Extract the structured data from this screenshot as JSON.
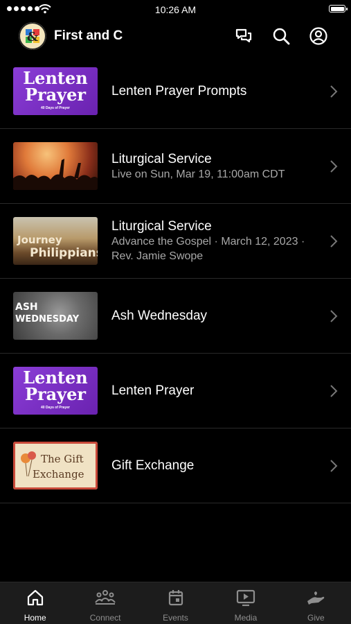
{
  "status": {
    "time": "10:26 AM"
  },
  "header": {
    "title": "First and C"
  },
  "items": [
    {
      "title": "Lenten Prayer Prompts",
      "subtitle": "",
      "thumb_line1": "Lenten",
      "thumb_line2": "Prayer",
      "thumb_caption": "40 Days of Prayer"
    },
    {
      "title": "Liturgical Service",
      "subtitle": "Live on Sun, Mar 19, 11:00am CDT"
    },
    {
      "title": "Liturgical Service",
      "subtitle": "Advance the Gospel · March 12, 2023 · Rev. Jamie Swope",
      "thumb_line1": "Journey",
      "thumb_line2": "Philippians"
    },
    {
      "title": "Ash Wednesday",
      "subtitle": "",
      "thumb_line1": "ASH",
      "thumb_line2": "WEDNESDAY"
    },
    {
      "title": "Lenten Prayer",
      "subtitle": "",
      "thumb_line1": "Lenten",
      "thumb_line2": "Prayer",
      "thumb_caption": "40 Days of Prayer"
    },
    {
      "title": "Gift Exchange",
      "subtitle": "",
      "thumb_line1": "The Gift",
      "thumb_line2": "Exchange"
    }
  ],
  "tabs": [
    {
      "label": "Home",
      "icon": "home-icon",
      "active": true
    },
    {
      "label": "Connect",
      "icon": "people-icon"
    },
    {
      "label": "Events",
      "icon": "calendar-icon"
    },
    {
      "label": "Media",
      "icon": "play-icon"
    },
    {
      "label": "Give",
      "icon": "hand-icon"
    }
  ],
  "colors": {
    "accent": "#ffffff",
    "inactive": "#8e8e8e",
    "purple": "#7b2fbf"
  }
}
